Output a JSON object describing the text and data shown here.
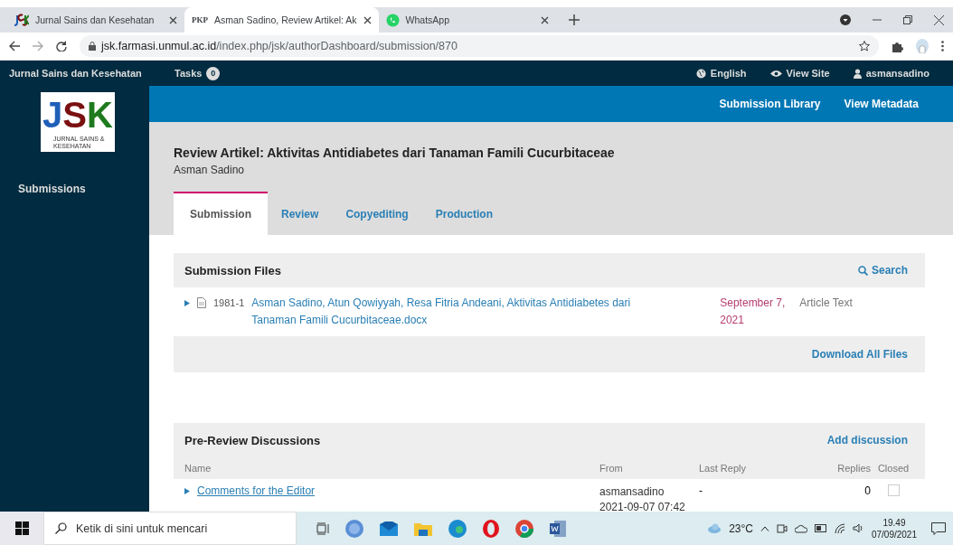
{
  "browser": {
    "tabs": [
      {
        "kind": "jsk",
        "title": "Jurnal Sains dan Kesehatan",
        "selected": false
      },
      {
        "kind": "pkp",
        "icon_text": "PKP",
        "title": "Asman Sadino, Review Artikel: Ak",
        "selected": true
      },
      {
        "kind": "whatsapp",
        "title": "WhatsApp",
        "selected": false
      }
    ],
    "url": {
      "host": "jsk.farmasi.unmul.ac.id",
      "path": "/index.php/jsk/authorDashboard/submission/870"
    }
  },
  "app_header": {
    "site_title": "Jurnal Sains dan Kesehatan",
    "tasks_label": "Tasks",
    "tasks_count": "0",
    "links": [
      {
        "kind": "globe",
        "label": "English"
      },
      {
        "kind": "eye",
        "label": "View Site"
      },
      {
        "kind": "user",
        "label": "asmansadino"
      }
    ]
  },
  "sidebar": {
    "logo": {
      "letters": [
        {
          "text": "J",
          "color": "#1f5fb8"
        },
        {
          "text": "S",
          "color": "#7a1010"
        },
        {
          "text": "K",
          "color": "#1e7a1e"
        }
      ],
      "caption": [
        "JURNAL SAINS &",
        "KESEHATAN"
      ]
    },
    "items": [
      {
        "label": "Submissions"
      }
    ]
  },
  "actions": [
    "Submission Library",
    "View Metadata"
  ],
  "submission": {
    "title": "Review Artikel: Aktivitas Antidiabetes dari Tanaman Famili Cucurbitaceae",
    "author": "Asman Sadino",
    "tabs": [
      {
        "label": "Submission",
        "selected": true
      },
      {
        "label": "Review",
        "selected": false
      },
      {
        "label": "Copyediting",
        "selected": false
      },
      {
        "label": "Production",
        "selected": false
      }
    ]
  },
  "files": {
    "title": "Submission Files",
    "search_label": "Search",
    "rows": [
      {
        "id": "1981-1",
        "name": "Asman Sadino, Atun Qowiyyah, Resa Fitria Andeani, Aktivitas Antidiabetes dari Tanaman Famili Cucurbitaceae.docx",
        "date": "September 7, 2021",
        "type": "Article Text"
      }
    ],
    "footer_link": "Download All Files"
  },
  "discussions": {
    "title": "Pre-Review Discussions",
    "add_label": "Add discussion",
    "columns": [
      "Name",
      "From",
      "Last Reply",
      "Replies",
      "Closed"
    ],
    "rows": [
      {
        "name": "Comments for the Editor",
        "from": "asmansadino",
        "from_time": "2021-09-07 07:42",
        "last_reply": "-",
        "replies": "0",
        "closed": false
      }
    ]
  },
  "taskbar": {
    "search_placeholder": "Ketik di sini untuk mencari",
    "temperature": "23°C",
    "time": "19.49",
    "date": "07/09/2021"
  }
}
